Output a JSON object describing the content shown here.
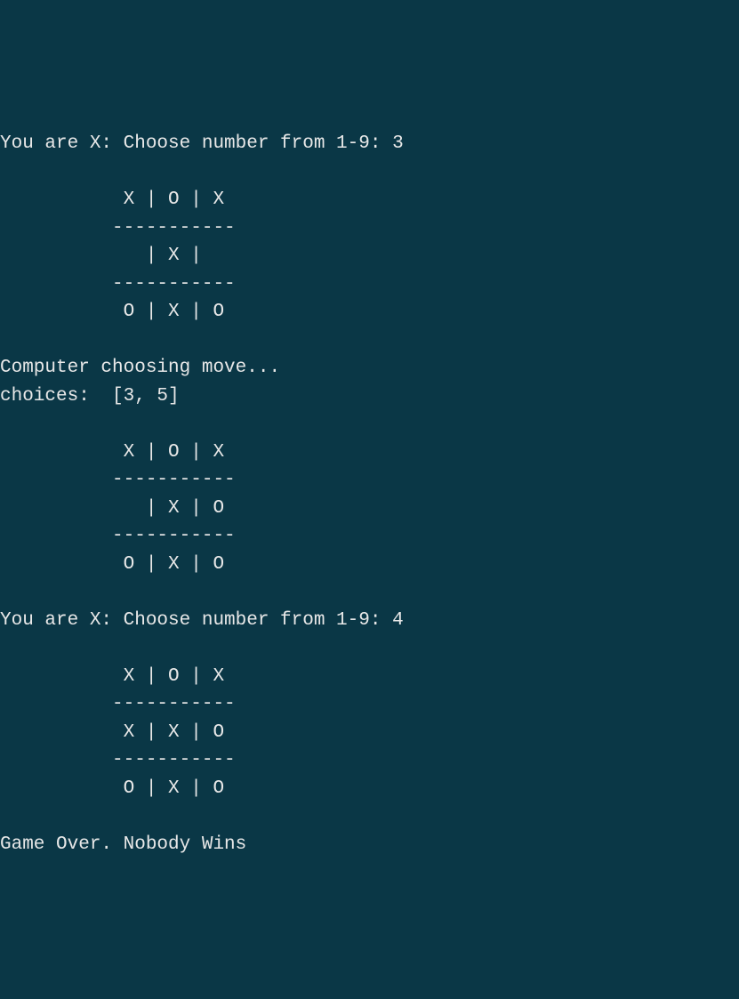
{
  "lines": {
    "prompt1": "You are X: Choose number from 1-9: 3",
    "board1_row1": "           X | O | X",
    "board1_div1": "          -----------",
    "board1_row2": "             | X |",
    "board1_div2": "          -----------",
    "board1_row3": "           O | X | O",
    "computer_msg": "Computer choosing move...",
    "choices": "choices:  [3, 5]",
    "board2_row1": "           X | O | X",
    "board2_div1": "          -----------",
    "board2_row2": "             | X | O",
    "board2_div2": "          -----------",
    "board2_row3": "           O | X | O",
    "prompt2": "You are X: Choose number from 1-9: 4",
    "board3_row1": "           X | O | X",
    "board3_div1": "          -----------",
    "board3_row2": "           X | X | O",
    "board3_div2": "          -----------",
    "board3_row3": "           O | X | O",
    "gameover": "Game Over. Nobody Wins"
  }
}
